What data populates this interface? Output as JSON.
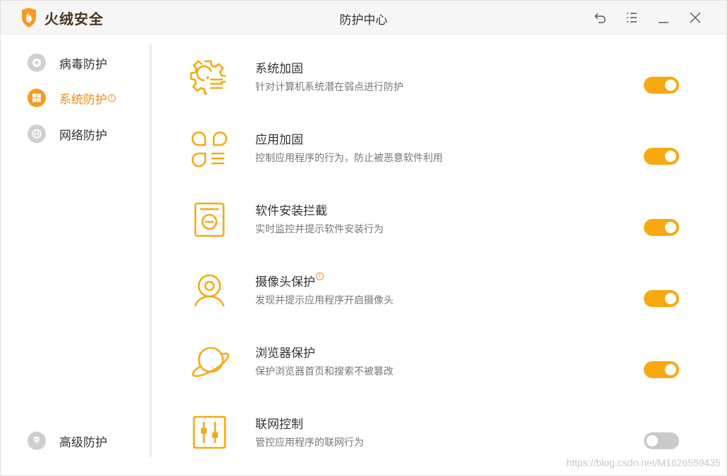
{
  "app": {
    "brand_name": "火绒安全",
    "window_title": "防护中心",
    "brand_color": "#f59b22"
  },
  "window_controls": [
    "back-icon",
    "menu-icon",
    "minimize-icon",
    "close-icon"
  ],
  "sidebar": {
    "items": [
      {
        "label": "病毒防护",
        "icon": "plus-shield-icon",
        "active": false
      },
      {
        "label": "系统防护",
        "icon": "windows-icon",
        "active": true,
        "alert": "!"
      },
      {
        "label": "网络防护",
        "icon": "globe-icon",
        "active": false
      },
      {
        "label": "高级防护",
        "icon": "diamond-icon",
        "active": false
      }
    ]
  },
  "main": {
    "items": [
      {
        "title": "系统加固",
        "desc": "针对计算机系统潜在弱点进行防护",
        "icon": "gear-list-icon",
        "enabled": true
      },
      {
        "title": "应用加固",
        "desc": "控制应用程序的行为，防止被恶意软件利用",
        "icon": "apps-list-icon",
        "enabled": true
      },
      {
        "title": "软件安装拦截",
        "desc": "实时监控并提示软件安装行为",
        "icon": "install-block-icon",
        "enabled": true
      },
      {
        "title": "摄像头保护",
        "desc": "发现并提示应用程序开启摄像头",
        "icon": "webcam-icon",
        "enabled": true,
        "alert": "!"
      },
      {
        "title": "浏览器保护",
        "desc": "保护浏览器首页和搜索不被篡改",
        "icon": "planet-icon",
        "enabled": true
      },
      {
        "title": "联网控制",
        "desc": "管控应用程序的联网行为",
        "icon": "sliders-icon",
        "enabled": false
      }
    ]
  },
  "watermark": "https://blog.csdn.net/M1626559435",
  "colors": {
    "accent": "#f8a90f",
    "active_text": "#f08c1a",
    "toggle_off": "#cacaca"
  }
}
